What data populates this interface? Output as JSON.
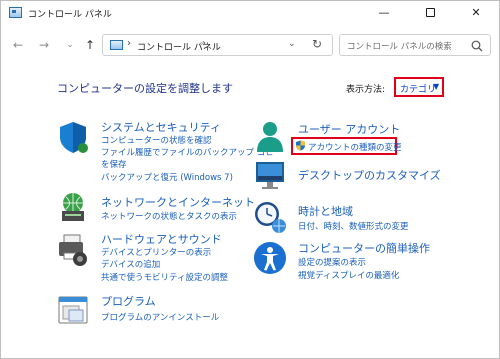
{
  "window": {
    "title": "コントロール パネル",
    "controls": {
      "minimize": "—",
      "close": "✕"
    }
  },
  "nav": {
    "back": "←",
    "forward": "→",
    "recent": "⌄",
    "up": "↑",
    "address_sep": "›",
    "address_text": "コントロール パネル",
    "address_dropdown": "⌄",
    "refresh": "↻",
    "search_placeholder": "コントロール パネルの検索"
  },
  "main": {
    "heading": "コンピューターの設定を調整します",
    "view_by_label": "表示方法:",
    "view_by_value": "カテゴリ",
    "view_by_arrow": "▼"
  },
  "categories_left": [
    {
      "icon": "shield-icon",
      "title": "システムとセキュリティ",
      "links": [
        "コンピューターの状態を確認",
        "ファイル履歴でファイルのバックアップ コピー",
        "を保存",
        "バックアップと復元 (Windows 7)"
      ]
    },
    {
      "icon": "network-icon",
      "title": "ネットワークとインターネット",
      "links": [
        "ネットワークの状態とタスクの表示"
      ]
    },
    {
      "icon": "printer-icon",
      "title": "ハードウェアとサウンド",
      "links": [
        "デバイスとプリンターの表示",
        "デバイスの追加",
        "共通で使うモビリティ設定の調整"
      ]
    },
    {
      "icon": "programs-icon",
      "title": "プログラム",
      "links": [
        "プログラムのアンインストール"
      ]
    }
  ],
  "categories_right": [
    {
      "icon": "user-icon",
      "title": "ユーザー アカウント",
      "links": [
        "アカウントの種類の変更"
      ]
    },
    {
      "icon": "desktop-icon",
      "title": "デスクトップのカスタマイズ",
      "links": []
    },
    {
      "icon": "clock-icon",
      "title": "時計と地域",
      "links": [
        "日付、時刻、数値形式の変更"
      ]
    },
    {
      "icon": "accessibility-icon",
      "title": "コンピューターの簡単操作",
      "links": [
        "設定の提案の表示",
        "視覚ディスプレイの最適化"
      ]
    }
  ],
  "colors": {
    "link": "#1a5fbb",
    "heading": "#1e3287",
    "highlight": "#e0001a"
  }
}
